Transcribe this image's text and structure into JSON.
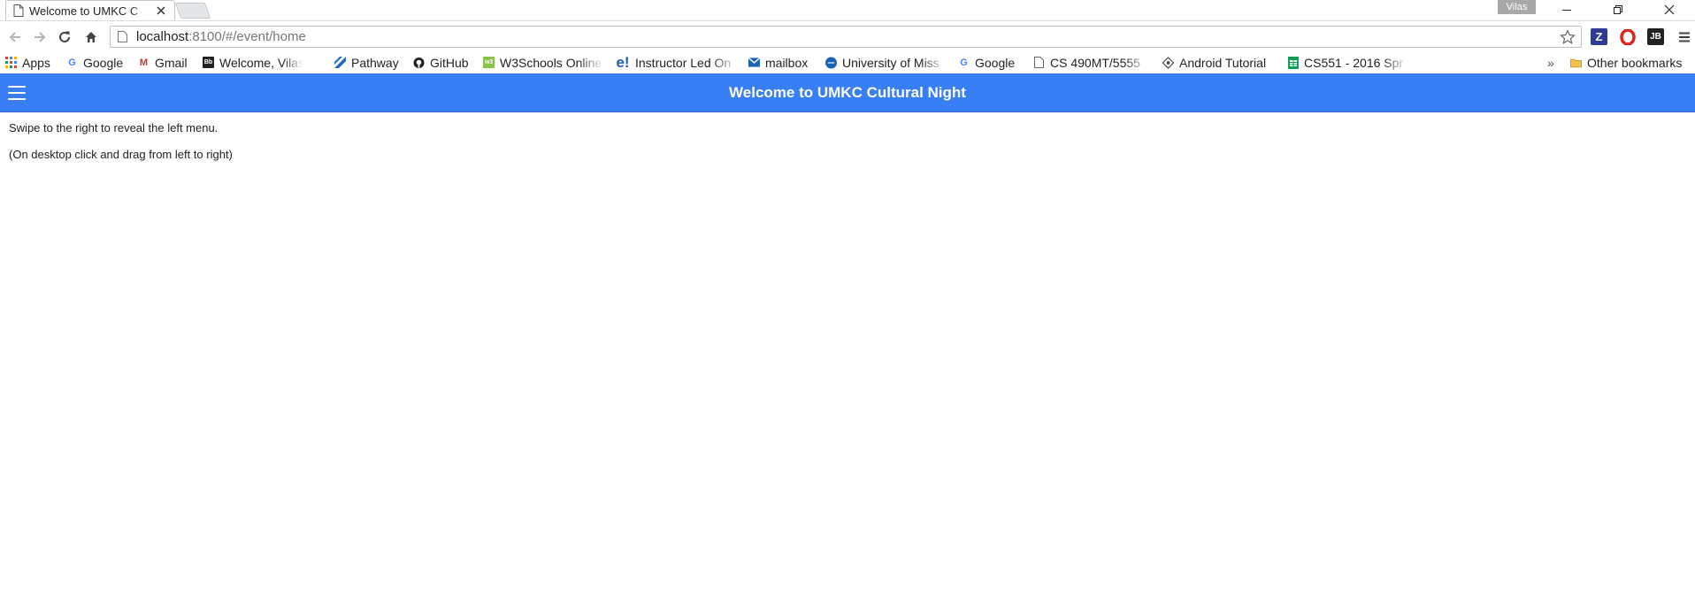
{
  "browser": {
    "tab_title": "Welcome to UMKC C",
    "profile_name": "Vilas",
    "url_host": "localhost",
    "url_rest": ":8100/#/event/home"
  },
  "bookmarks": [
    {
      "label": "Apps",
      "icon": "apps-grid-icon"
    },
    {
      "label": "Google",
      "icon": "google-icon"
    },
    {
      "label": "Gmail",
      "icon": "gmail-icon"
    },
    {
      "label": "Welcome, Vilas –",
      "icon": "bb-icon"
    },
    {
      "label": "Pathway",
      "icon": "pathway-icon"
    },
    {
      "label": "GitHub",
      "icon": "github-icon"
    },
    {
      "label": "W3Schools Online",
      "icon": "w3schools-icon"
    },
    {
      "label": "Instructor Led On",
      "icon": "e-icon"
    },
    {
      "label": "mailbox",
      "icon": "mail-icon"
    },
    {
      "label": "University of Miss",
      "icon": "umkc-icon"
    },
    {
      "label": "Google",
      "icon": "google-icon"
    },
    {
      "label": "CS 490MT/5555",
      "icon": "page-icon"
    },
    {
      "label": "Android Tutorial",
      "icon": "android-icon"
    },
    {
      "label": "CS551 - 2016 Spr",
      "icon": "sheets-icon"
    }
  ],
  "overflow_label": "»",
  "other_bookmarks_label": "Other bookmarks",
  "app": {
    "title": "Welcome to UMKC Cultural Night",
    "line1": "Swipe to the right to reveal the left menu.",
    "line2": "(On desktop click and drag from left to right)"
  },
  "colors": {
    "header": "#387ef5",
    "text": "#222222"
  }
}
